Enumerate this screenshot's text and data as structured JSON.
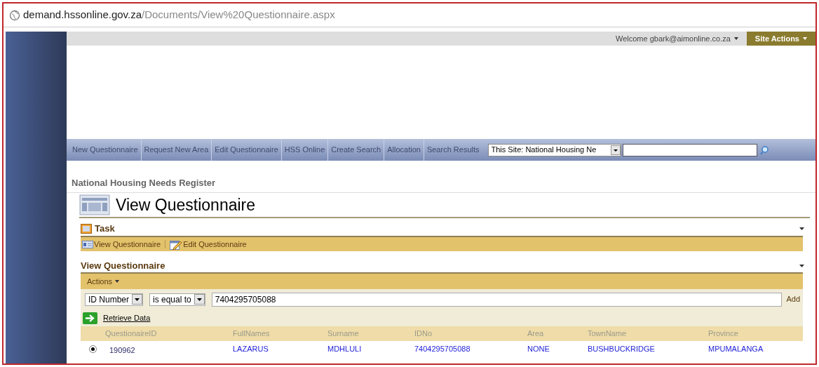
{
  "address_bar": {
    "host": "demand.hssonline.gov.za",
    "path": "/Documents/View%20Questionnaire.aspx"
  },
  "top_bar": {
    "welcome": "Welcome gbark@aimonline.co.za",
    "site_actions": "Site Actions"
  },
  "nav": {
    "items": [
      "New Questionnaire",
      "Request New Area",
      "Edit Questionnaire",
      "HSS Online",
      "Create Search",
      "Allocation",
      "Search Results"
    ],
    "scope": "This Site: National Housing Ne"
  },
  "breadcrumb": "National Housing Needs Register",
  "page_title": "View Questionnaire",
  "task": {
    "title": "Task",
    "links": [
      "View Questionnaire",
      "Edit Questionnaire"
    ]
  },
  "view": {
    "title": "View Questionnaire",
    "actions": "Actions",
    "filter_field": "ID Number",
    "filter_op": "is equal to",
    "filter_value": "7404295705088",
    "add": "Add",
    "retrieve": "Retrieve Data"
  },
  "table": {
    "columns": [
      "QuestionaireID",
      "FullNames",
      "Surname",
      "IDNo",
      "Area",
      "TownName",
      "Province"
    ],
    "rows": [
      {
        "selected": true,
        "cells": [
          "190962",
          "LAZARUS",
          "MDHLULI",
          "7404295705088",
          "NONE",
          "BUSHBUCKRIDGE",
          "MPUMALANGA"
        ]
      }
    ]
  }
}
